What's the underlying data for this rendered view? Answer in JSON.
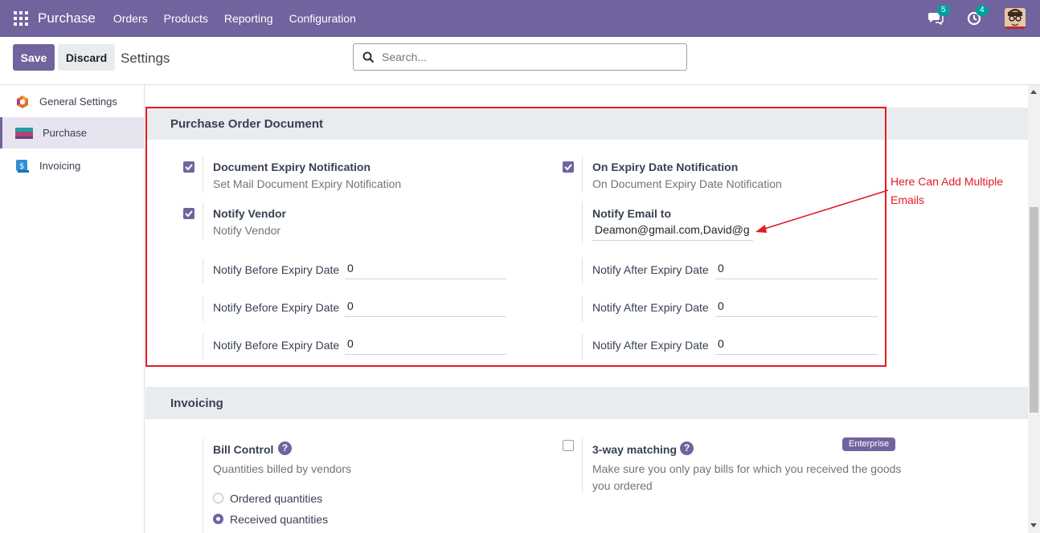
{
  "topbar": {
    "app_name": "Purchase",
    "menu": [
      "Orders",
      "Products",
      "Reporting",
      "Configuration"
    ],
    "messages_count": "5",
    "activities_count": "4"
  },
  "controls": {
    "save_label": "Save",
    "discard_label": "Discard",
    "breadcrumb": "Settings",
    "search_placeholder": "Search..."
  },
  "sidebar": {
    "items": [
      {
        "label": "General Settings"
      },
      {
        "label": "Purchase"
      },
      {
        "label": "Invoicing"
      }
    ]
  },
  "purchase_doc": {
    "header": "Purchase Order Document",
    "doc_expiry_title": "Document Expiry Notification",
    "doc_expiry_desc": "Set Mail Document Expiry Notification",
    "on_expiry_title": "On Expiry Date Notification",
    "on_expiry_desc": "On Document Expiry Date Notification",
    "notify_vendor_title": "Notify Vendor",
    "notify_vendor_desc": "Notify Vendor",
    "notify_email_title": "Notify Email to",
    "notify_email_value": "Deamon@gmail.com,David@g",
    "before_label": "Notify Before Expiry Date",
    "after_label": "Notify After Expiry Date",
    "before_values": [
      "0",
      "0",
      "0"
    ],
    "after_values": [
      "0",
      "0",
      "0"
    ]
  },
  "annotation": {
    "text": "Here Can Add Multiple Emails"
  },
  "invoicing": {
    "header": "Invoicing",
    "bill_control_title": "Bill Control",
    "bill_control_desc": "Quantities billed by vendors",
    "option_ordered": "Ordered quantities",
    "option_received": "Received quantities",
    "three_way_title": "3-way matching",
    "three_way_desc_line1": "Make sure you only pay bills for which you received the goods",
    "three_way_desc_line2": "you ordered",
    "enterprise_badge": "Enterprise"
  },
  "colors": {
    "brand": "#71639e",
    "highlight": "#e01b24",
    "badge": "#00a09d"
  }
}
